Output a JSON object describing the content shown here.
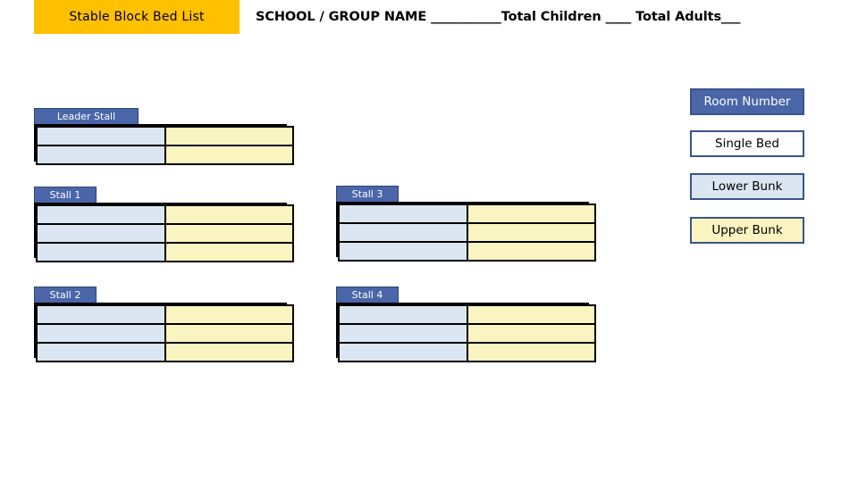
{
  "title_banner": {
    "label": "Stable Block Bed List",
    "background": "#ffc000"
  },
  "header": {
    "text": "SCHOOL / GROUP NAME ___________Total Children ____ Total Adults___"
  },
  "legend": {
    "items": [
      {
        "label": "Room Number",
        "fill": "#4a66a8",
        "text_color": "#ffffff"
      },
      {
        "label": "Single Bed",
        "fill": "#ffffff",
        "text_color": "#000000"
      },
      {
        "label": "Lower Bunk",
        "fill": "#dce6f2",
        "text_color": "#000000"
      },
      {
        "label": "Upper Bunk",
        "fill": "#faf4c0",
        "text_color": "#000000"
      }
    ]
  },
  "colors": {
    "label_blue": "#4a66a8",
    "lower_bunk": "#dce6f2",
    "upper_bunk": "#faf4c0",
    "border": "#000000",
    "banner_yellow": "#ffc000"
  },
  "stalls": [
    {
      "id": "leader-stall",
      "label": "Leader Stall",
      "rows": [
        {
          "left": "",
          "right": ""
        },
        {
          "left": "",
          "right": ""
        }
      ]
    },
    {
      "id": "stall-1",
      "label": "Stall 1",
      "rows": [
        {
          "left": "",
          "right": ""
        },
        {
          "left": "",
          "right": ""
        },
        {
          "left": "",
          "right": ""
        }
      ]
    },
    {
      "id": "stall-2",
      "label": "Stall 2",
      "rows": [
        {
          "left": "",
          "right": ""
        },
        {
          "left": "",
          "right": ""
        },
        {
          "left": "",
          "right": ""
        }
      ]
    },
    {
      "id": "stall-3",
      "label": "Stall 3",
      "rows": [
        {
          "left": "",
          "right": ""
        },
        {
          "left": "",
          "right": ""
        },
        {
          "left": "",
          "right": ""
        }
      ]
    },
    {
      "id": "stall-4",
      "label": "Stall 4",
      "rows": [
        {
          "left": "",
          "right": ""
        },
        {
          "left": "",
          "right": ""
        },
        {
          "left": "",
          "right": ""
        }
      ]
    }
  ]
}
